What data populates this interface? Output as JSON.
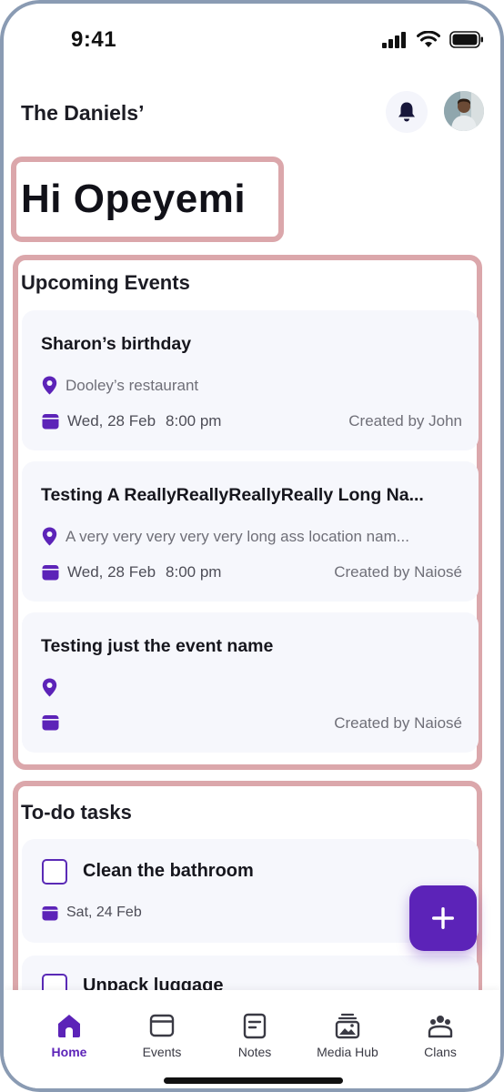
{
  "status_bar": {
    "time": "9:41"
  },
  "header": {
    "family_name": "The Daniels’",
    "icons": [
      "bell-icon",
      "avatar"
    ]
  },
  "greeting": "Hi Opeyemi",
  "events": {
    "title": "Upcoming Events",
    "items": [
      {
        "name": "Sharon’s birthday",
        "location": "Dooley’s restaurant",
        "date": "Wed, 28 Feb",
        "time": "8:00 pm",
        "created_by": "Created by John"
      },
      {
        "name": "Testing A ReallyReallyReallyReally Long Na...",
        "location": "A very very very very very long ass location nam...",
        "date": "Wed, 28 Feb",
        "time": "8:00 pm",
        "created_by": "Created by Naiosé"
      },
      {
        "name": "Testing just the event name",
        "location": "",
        "date": "",
        "time": "",
        "created_by": "Created by Naiosé"
      }
    ]
  },
  "todo": {
    "title": "To-do tasks",
    "items": [
      {
        "name": "Clean the bathroom",
        "date": "Sat, 24 Feb",
        "checked": false
      },
      {
        "name": "Unpack luggage",
        "date": "",
        "checked": false
      }
    ]
  },
  "fab": {
    "icon": "plus-icon"
  },
  "nav": {
    "items": [
      {
        "label": "Home",
        "icon": "home-icon",
        "active": true
      },
      {
        "label": "Events",
        "icon": "calendar-icon",
        "active": false
      },
      {
        "label": "Notes",
        "icon": "notes-icon",
        "active": false
      },
      {
        "label": "Media Hub",
        "icon": "media-hub-icon",
        "active": false
      },
      {
        "label": "Clans",
        "icon": "clans-icon",
        "active": false
      }
    ]
  },
  "colors": {
    "accent": "#5c23b8",
    "highlight_border": "#dba7ab",
    "card_bg": "#f6f7fc"
  }
}
